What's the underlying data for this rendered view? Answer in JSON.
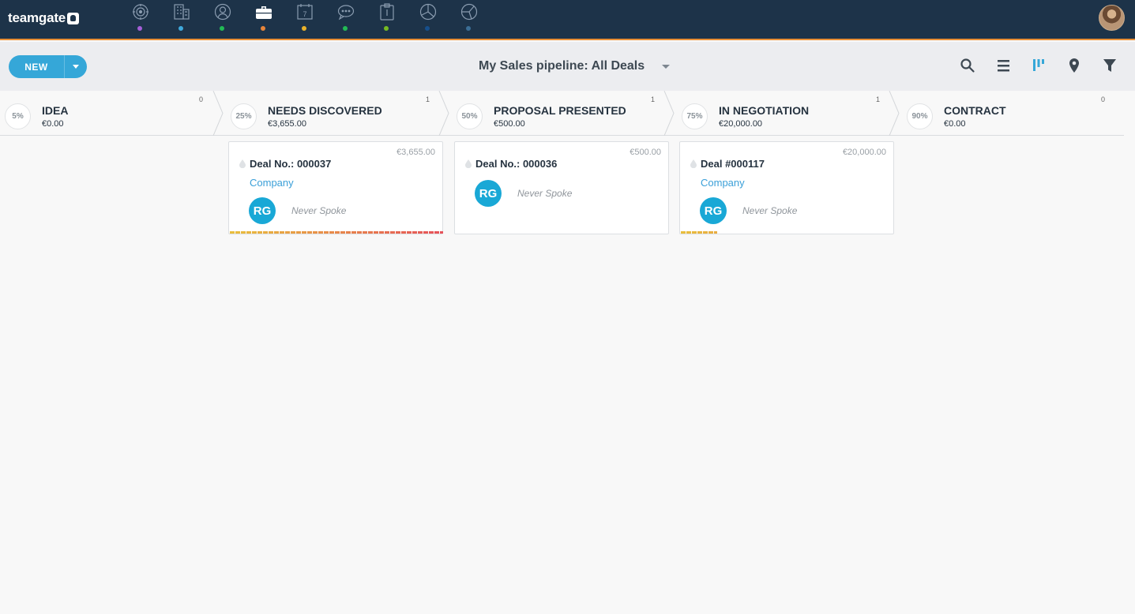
{
  "app": {
    "logo_text": "teamgate"
  },
  "nav": [
    {
      "icon": "target-icon",
      "dot_color": "#a55fd8"
    },
    {
      "icon": "buildings-icon",
      "dot_color": "#3fa9dc"
    },
    {
      "icon": "person-icon",
      "dot_color": "#22bb55"
    },
    {
      "icon": "briefcase-icon",
      "dot_color": "#e7853a",
      "active": true
    },
    {
      "icon": "calendar-icon",
      "calendar_number": "7",
      "dot_color": "#e9b22a"
    },
    {
      "icon": "chat-icon",
      "dot_color": "#22bb55"
    },
    {
      "icon": "clipboard-icon",
      "dot_color": "#76bb22"
    },
    {
      "icon": "pie-chart-icon",
      "dot_color": "#164f8c"
    },
    {
      "icon": "pie-chart-alt-icon",
      "dot_color": "#3b6e96"
    }
  ],
  "toolbar": {
    "new_label": "NEW",
    "pipeline_title": "My Sales pipeline: All Deals",
    "icons": [
      "search-icon",
      "list-view-icon",
      "kanban-view-icon",
      "map-pin-icon",
      "filter-icon"
    ],
    "active_view": "kanban-view-icon",
    "accent_color": "#35a7d8"
  },
  "stages": [
    {
      "percent": "5%",
      "name": "IDEA",
      "amount": "€0.00",
      "count": "0"
    },
    {
      "percent": "25%",
      "name": "NEEDS DISCOVERED",
      "amount": "€3,655.00",
      "count": "1"
    },
    {
      "percent": "50%",
      "name": "PROPOSAL PRESENTED",
      "amount": "€500.00",
      "count": "1"
    },
    {
      "percent": "75%",
      "name": "IN NEGOTIATION",
      "amount": "€20,000.00",
      "count": "1"
    },
    {
      "percent": "90%",
      "name": "CONTRACT",
      "amount": "€0.00",
      "count": "0"
    }
  ],
  "deals": [
    {
      "title": "Deal No.: 000037",
      "amount": "€3,655.00",
      "company": "Company",
      "owner_initials": "RG",
      "contact_status": "Never Spoke",
      "progress": 1.0
    },
    {
      "title": "Deal No.: 000036",
      "amount": "€500.00",
      "company": "",
      "owner_initials": "RG",
      "contact_status": "Never Spoke",
      "progress": 0
    },
    {
      "title": "Deal #000117",
      "amount": "€20,000.00",
      "company": "Company",
      "owner_initials": "RG",
      "contact_status": "Never Spoke",
      "progress": 0.17
    }
  ]
}
